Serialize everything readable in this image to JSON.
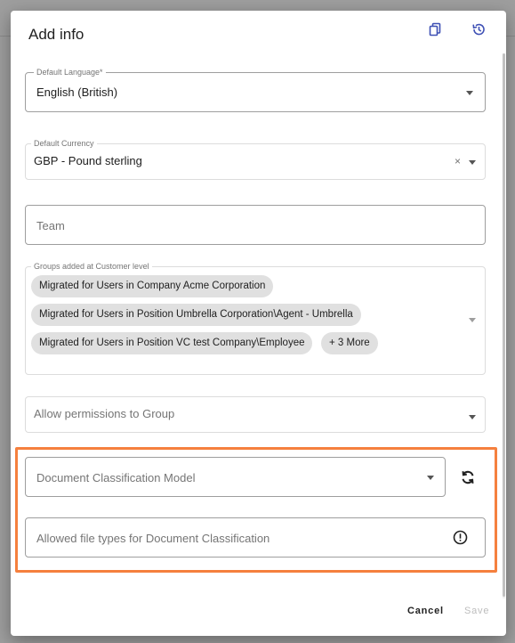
{
  "dialog": {
    "title": "Add info",
    "icons": {
      "copy": "copy-icon",
      "history": "history-icon"
    }
  },
  "fields": {
    "language": {
      "label": "Default Language*",
      "value": "English (British)"
    },
    "currency": {
      "label": "Default Currency",
      "value": "GBP - Pound sterling",
      "clear": "×"
    },
    "team": {
      "placeholder": "Team"
    },
    "groups": {
      "label": "Groups added at Customer level",
      "chips": [
        "Migrated for Users in Company Acme Corporation",
        "Migrated for Users in Position Umbrella Corporation\\Agent - Umbrella",
        "Migrated for Users in Position VC test Company\\Employee",
        "+ 3 More"
      ]
    },
    "permissions": {
      "placeholder": "Allow permissions to Group"
    },
    "doc_model": {
      "placeholder": "Document Classification Model"
    },
    "file_types": {
      "placeholder": "Allowed file types for Document Classification"
    }
  },
  "actions": {
    "cancel": "Cancel",
    "save": "Save"
  },
  "colors": {
    "highlight": "#f5803e",
    "accent": "#3f51b5"
  }
}
